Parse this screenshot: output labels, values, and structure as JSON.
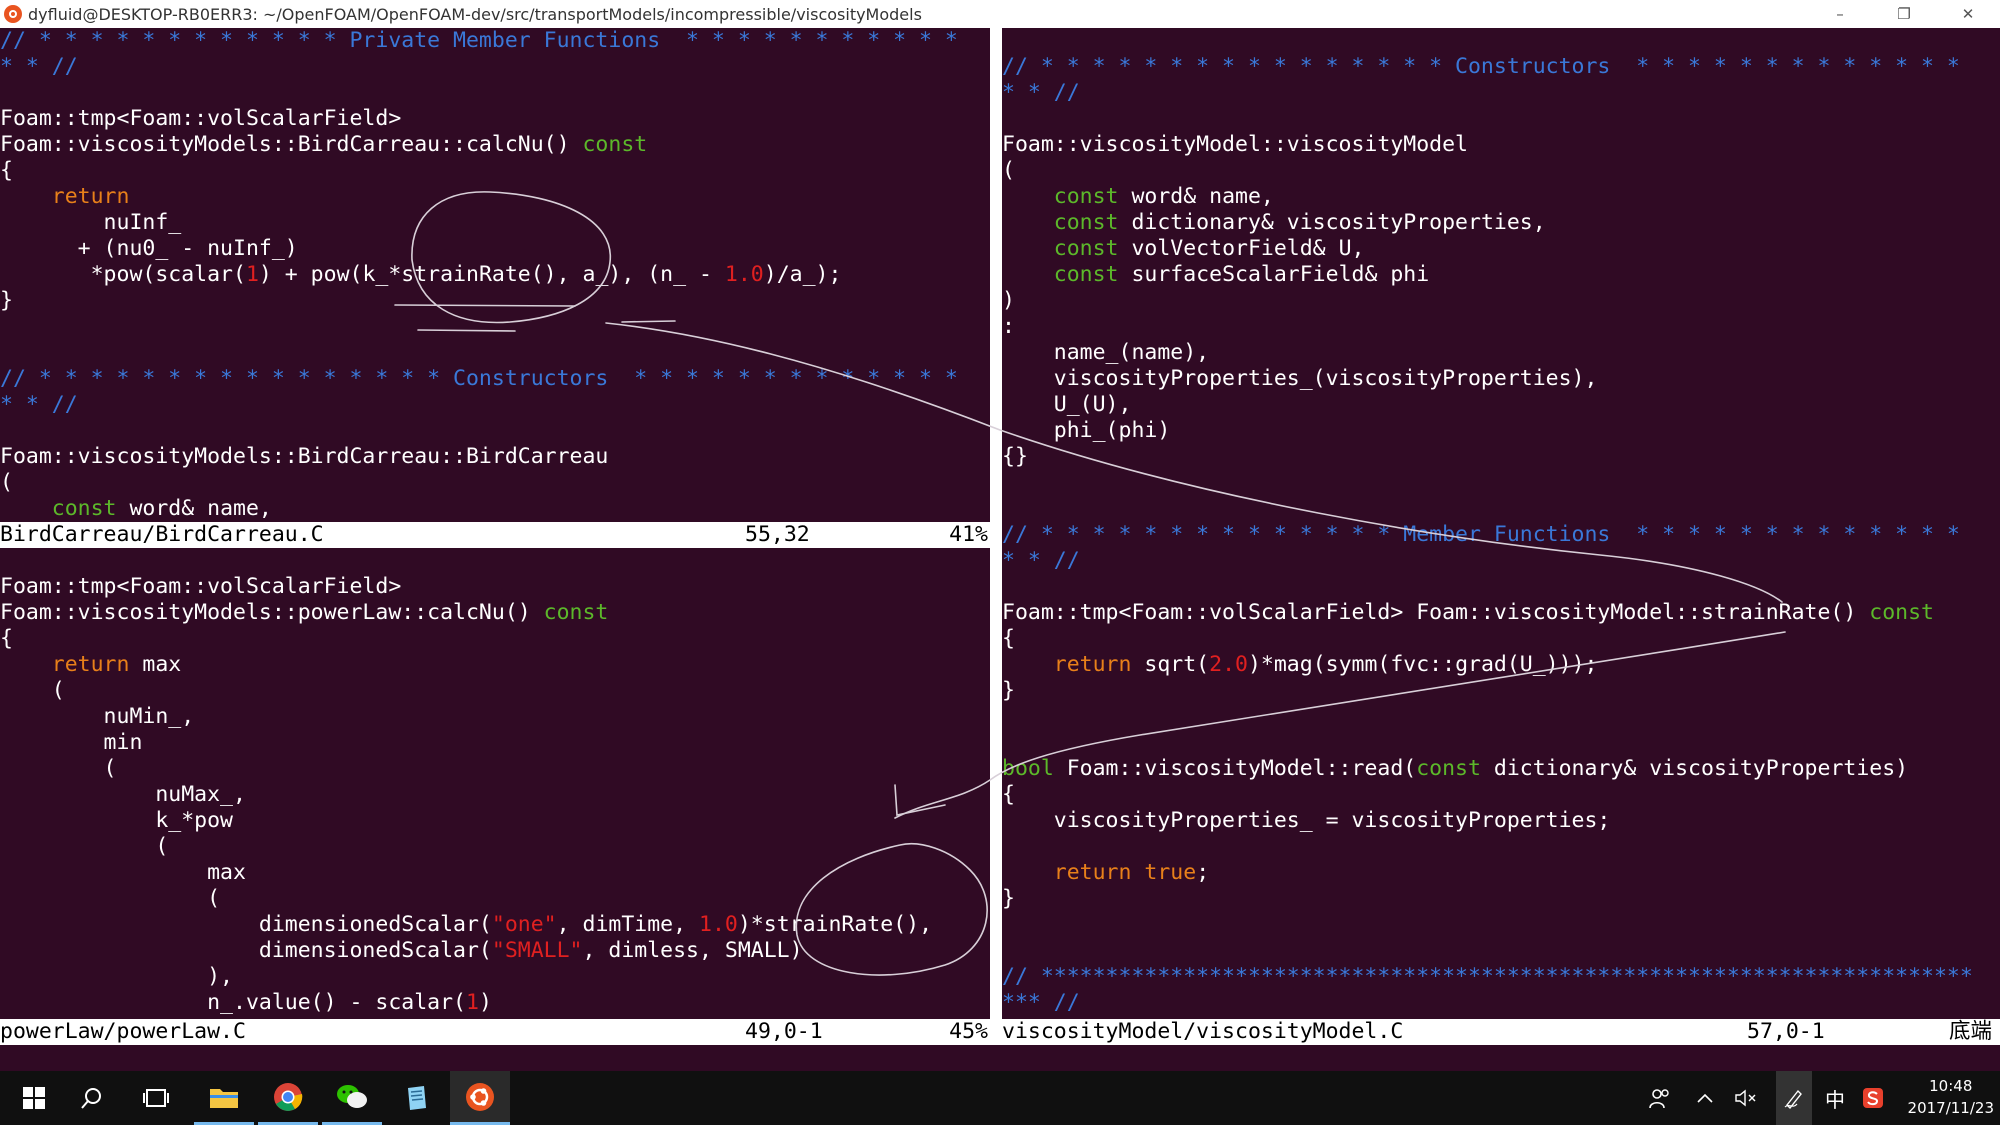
{
  "window": {
    "title": "dyfluid@DESKTOP-RB0ERR3: ~/OpenFOAM/OpenFOAM-dev/src/transportModels/incompressible/viscosityModels",
    "minimize": "–",
    "maximize": "❐",
    "close": "✕"
  },
  "panes": {
    "top_left": {
      "lines": [
        [
          [
            "cmt",
            "// * * * * * * * * * * * * Private Member Functions  * * * * * * * * * * *"
          ]
        ],
        [
          [
            "cmt",
            "* * //"
          ]
        ],
        [],
        [
          [
            "",
            "Foam::tmp<Foam::volScalarField>"
          ]
        ],
        [
          [
            "",
            "Foam::viscosityModels::BirdCarreau::calcNu() "
          ],
          [
            "kw",
            "const"
          ]
        ],
        [
          [
            "",
            "{"
          ]
        ],
        [
          [
            "",
            "    "
          ],
          [
            "ret",
            "return"
          ]
        ],
        [
          [
            "",
            "        nuInf_"
          ]
        ],
        [
          [
            "",
            "      + (nu0_ - nuInf_)"
          ]
        ],
        [
          [
            "",
            "       *pow(scalar("
          ],
          [
            "num",
            "1"
          ],
          [
            "",
            ") + pow(k_*strainRate(), a_), (n_ - "
          ],
          [
            "num",
            "1.0"
          ],
          [
            "",
            ")/a_);"
          ]
        ],
        [
          [
            "",
            "}"
          ]
        ],
        [],
        [],
        [
          [
            "cmt",
            "// * * * * * * * * * * * * * * * * Constructors  * * * * * * * * * * * * *"
          ]
        ],
        [
          [
            "cmt",
            "* * //"
          ]
        ],
        [],
        [
          [
            "",
            "Foam::viscosityModels::BirdCarreau::BirdCarreau"
          ]
        ],
        [
          [
            "",
            "("
          ]
        ],
        [
          [
            "",
            "    "
          ],
          [
            "kw",
            "const"
          ],
          [
            "",
            " word& name,"
          ]
        ]
      ],
      "status_file": "BirdCarreau/BirdCarreau.C",
      "status_pos": "55,32",
      "status_pct": "41%"
    },
    "bottom_left": {
      "lines": [
        [],
        [
          [
            "",
            "Foam::tmp<Foam::volScalarField>"
          ]
        ],
        [
          [
            "",
            "Foam::viscosityModels::powerLaw::calcNu() "
          ],
          [
            "kw",
            "const"
          ]
        ],
        [
          [
            "",
            "{"
          ]
        ],
        [
          [
            "",
            "    "
          ],
          [
            "ret",
            "return"
          ],
          [
            "",
            " max"
          ]
        ],
        [
          [
            "",
            "    ("
          ]
        ],
        [
          [
            "",
            "        nuMin_,"
          ]
        ],
        [
          [
            "",
            "        min"
          ]
        ],
        [
          [
            "",
            "        ("
          ]
        ],
        [
          [
            "",
            "            nuMax_,"
          ]
        ],
        [
          [
            "",
            "            k_*pow"
          ]
        ],
        [
          [
            "",
            "            ("
          ]
        ],
        [
          [
            "",
            "                max"
          ]
        ],
        [
          [
            "",
            "                ("
          ]
        ],
        [
          [
            "",
            "                    dimensionedScalar("
          ],
          [
            "str",
            "\"one\""
          ],
          [
            "",
            ", dimTime, "
          ],
          [
            "num",
            "1.0"
          ],
          [
            "",
            ")*strainRate(),"
          ]
        ],
        [
          [
            "",
            "                    dimensionedScalar("
          ],
          [
            "str",
            "\"SMALL\""
          ],
          [
            "",
            ", dimless, SMALL)"
          ]
        ],
        [
          [
            "",
            "                ),"
          ]
        ],
        [
          [
            "",
            "                n_.value() - scalar("
          ],
          [
            "num",
            "1"
          ],
          [
            ")",
            ")"
          ]
        ]
      ],
      "status_file": "powerLaw/powerLaw.C",
      "status_pos": "49,0-1",
      "status_pct": "45%"
    },
    "right": {
      "lines": [
        [],
        [
          [
            "cmt",
            "// * * * * * * * * * * * * * * * * Constructors  * * * * * * * * * * * * *"
          ]
        ],
        [
          [
            "cmt",
            "* * //"
          ]
        ],
        [],
        [
          [
            "",
            "Foam::viscosityModel::viscosityModel"
          ]
        ],
        [
          [
            "",
            "("
          ]
        ],
        [
          [
            "",
            "    "
          ],
          [
            "kw",
            "const"
          ],
          [
            "",
            " word& name,"
          ]
        ],
        [
          [
            "",
            "    "
          ],
          [
            "kw",
            "const"
          ],
          [
            "",
            " dictionary& viscosityProperties,"
          ]
        ],
        [
          [
            "",
            "    "
          ],
          [
            "kw",
            "const"
          ],
          [
            "",
            " volVectorField& U,"
          ]
        ],
        [
          [
            "",
            "    "
          ],
          [
            "kw",
            "const"
          ],
          [
            "",
            " surfaceScalarField& phi"
          ]
        ],
        [
          [
            "",
            ")"
          ]
        ],
        [
          [
            "",
            ":"
          ]
        ],
        [
          [
            "",
            "    name_(name),"
          ]
        ],
        [
          [
            "",
            "    viscosityProperties_(viscosityProperties),"
          ]
        ],
        [
          [
            "",
            "    U_(U),"
          ]
        ],
        [
          [
            "",
            "    phi_(phi)"
          ]
        ],
        [
          [
            "",
            "{}"
          ]
        ],
        [],
        [],
        [
          [
            "cmt",
            "// * * * * * * * * * * * * * * Member Functions  * * * * * * * * * * * * *"
          ]
        ],
        [
          [
            "cmt",
            "* * //"
          ]
        ],
        [],
        [
          [
            "",
            "Foam::tmp<Foam::volScalarField> Foam::viscosityModel::strainRate() "
          ],
          [
            "kw",
            "const"
          ]
        ],
        [
          [
            "",
            "{"
          ]
        ],
        [
          [
            "",
            "    "
          ],
          [
            "ret",
            "return"
          ],
          [
            "",
            " sqrt("
          ],
          [
            "num",
            "2.0"
          ],
          [
            "",
            ")*mag(symm(fvc::grad(U_)));"
          ]
        ],
        [
          [
            "",
            "}"
          ]
        ],
        [],
        [],
        [
          [
            "kw",
            "bool"
          ],
          [
            "",
            " Foam::viscosityModel::read("
          ],
          [
            "kw",
            "const"
          ],
          [
            "",
            " dictionary& viscosityProperties)"
          ]
        ],
        [
          [
            "",
            "{"
          ]
        ],
        [
          [
            "",
            "    viscosityProperties_ = viscosityProperties;"
          ]
        ],
        [],
        [
          [
            "",
            "    "
          ],
          [
            "ret",
            "return"
          ],
          [
            "",
            " "
          ],
          [
            "ret",
            "true"
          ],
          [
            "",
            ";"
          ]
        ],
        [
          [
            "",
            "}"
          ]
        ],
        [],
        [],
        [
          [
            "cmt",
            "// ************************************************************************"
          ]
        ],
        [
          [
            "cmt",
            "*** //"
          ]
        ]
      ],
      "status_file": "viscosityModel/viscosityModel.C",
      "status_pos": "57,0-1",
      "status_pct": "底端"
    }
  },
  "taskbar": {
    "icons": [
      "windows-start-icon",
      "search-icon",
      "task-view-icon",
      "file-explorer-icon",
      "chrome-icon",
      "wechat-icon",
      "notepad-icon",
      "ubuntu-icon"
    ],
    "tray_ime": "中",
    "time": "10:48",
    "date": "2017/11/23"
  },
  "colors": {
    "background": "#300a24",
    "comment": "#3a78d8",
    "keyword": "#5cb82a",
    "return_keyword": "#e8801a",
    "number_string": "#e02020"
  }
}
